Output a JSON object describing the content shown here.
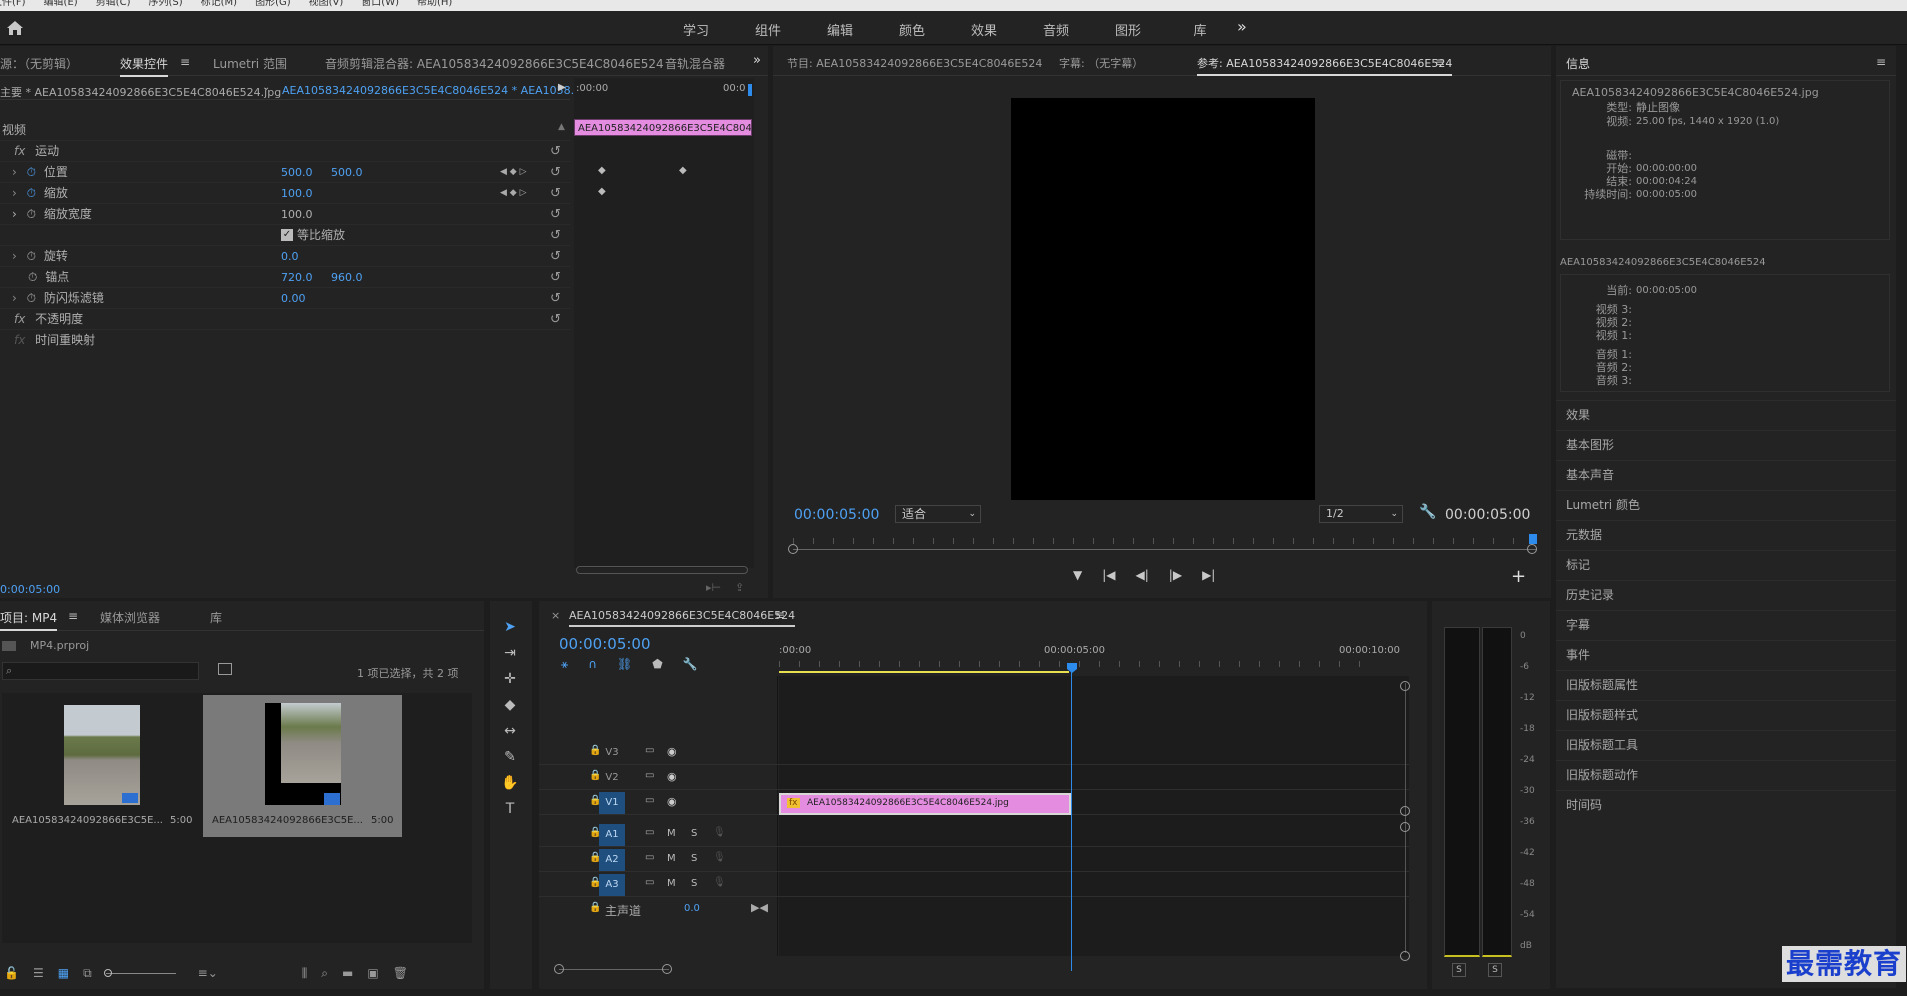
{
  "menu": {
    "items": [
      "文件(F)",
      "编辑(E)",
      "剪辑(C)",
      "序列(S)",
      "标记(M)",
      "图形(G)",
      "视图(V)",
      "窗口(W)",
      "帮助(H)"
    ]
  },
  "workspace": {
    "tabs": [
      "学习",
      "组件",
      "编辑",
      "颜色",
      "效果",
      "音频",
      "图形",
      "库"
    ],
    "more": "»"
  },
  "source_panel": {
    "tabs": [
      "源：（无剪辑）",
      "效果控件",
      "Lumetri 范围",
      "音频剪辑混合器: AEA10583424092866E3C5E4C8046E524",
      "音轨混合器"
    ],
    "master_label": "主要 * AEA10583424092866E3C5E4C8046E524.jpg",
    "clip_label": "AEA10583424092866E3C5E4C8046E524 * AEA1058...",
    "time_start": ":00:00",
    "time_end": "00:0",
    "clip_bar_label": "AEA10583424092866E3C5E4C8046",
    "video_header": "视频",
    "motion": "运动",
    "position": {
      "label": "位置",
      "x": "500.0",
      "y": "500.0"
    },
    "scale": {
      "label": "缩放",
      "value": "100.0"
    },
    "scale_width": {
      "label": "缩放宽度",
      "value": "100.0"
    },
    "uniform_scale": "等比缩放",
    "rotation": {
      "label": "旋转",
      "value": "0.0"
    },
    "anchor": {
      "label": "锚点",
      "x": "720.0",
      "y": "960.0"
    },
    "flicker": {
      "label": "防闪烁滤镜",
      "value": "0.00"
    },
    "opacity": "不透明度",
    "time_remap": "时间重映射",
    "timecode": "0:00:05:00"
  },
  "program_panel": {
    "tabs": [
      "节目: AEA10583424092866E3C5E4C8046E524",
      "字幕: （无字幕）",
      "参考: AEA10583424092866E3C5E4C8046E524"
    ],
    "timecode_left": "00:00:05:00",
    "fit": "适合",
    "resolution": "1/2",
    "timecode_right": "00:00:05:00"
  },
  "info_panel": {
    "title": "信息",
    "file": "AEA10583424092866E3C5E4C8046E524.jpg",
    "type_label": "类型:",
    "type_value": "静止图像",
    "video_label": "视频:",
    "video_value": "25.00 fps, 1440 x 1920 (1.0)",
    "tape_label": "磁带:",
    "start_label": "开始:",
    "start_value": "00:00:00:00",
    "end_label": "结束:",
    "end_value": "00:00:04:24",
    "duration_label": "持续时间:",
    "duration_value": "00:00:05:00",
    "seq_name": "AEA10583424092866E3C5E4C8046E524",
    "current_label": "当前:",
    "current_value": "00:00:05:00",
    "v3": "视频 3:",
    "v2": "视频 2:",
    "v1": "视频 1:",
    "a1": "音频 1:",
    "a2": "音频 2:",
    "a3": "音频 3:"
  },
  "sidebar": {
    "items": [
      "效果",
      "基本图形",
      "基本声音",
      "Lumetri 颜色",
      "元数据",
      "标记",
      "历史记录",
      "字幕",
      "事件",
      "旧版标题属性",
      "旧版标题样式",
      "旧版标题工具",
      "旧版标题动作",
      "时间码"
    ]
  },
  "project_panel": {
    "tabs": [
      "项目: MP4",
      "媒体浏览器",
      "库"
    ],
    "project_file": "MP4.prproj",
    "selection_status": "1 项已选择，共 2 项",
    "items": [
      {
        "name": "AEA10583424092866E3C5E...",
        "duration": "5:00"
      },
      {
        "name": "AEA10583424092866E3C5E...",
        "duration": "5:00"
      }
    ]
  },
  "timeline": {
    "sequence_name": "AEA10583424092866E3C5E4C8046E524",
    "timecode": "00:00:05:00",
    "ruler": [
      ":00:00",
      "00:00:05:00",
      "00:00:10:00"
    ],
    "video_tracks": [
      "V3",
      "V2",
      "V1"
    ],
    "audio_tracks": [
      "A1",
      "A2",
      "A3"
    ],
    "mute": "M",
    "solo": "S",
    "master": "主声道",
    "master_value": "0.0",
    "clip_label": "AEA10583424092866E3C5E4C8046E524.jpg",
    "clip_fx": "fx"
  },
  "meter": {
    "labels": [
      "0",
      "-6",
      "-12",
      "-18",
      "-24",
      "-30",
      "-36",
      "-42",
      "-48",
      "-54",
      "dB"
    ],
    "solo_l": "S",
    "solo_r": "S"
  },
  "watermark": "最需教育",
  "colors": {
    "accent": "#4ea1f3",
    "clip_pink": "#e38ce0",
    "track_blue": "#1f4f7f"
  }
}
